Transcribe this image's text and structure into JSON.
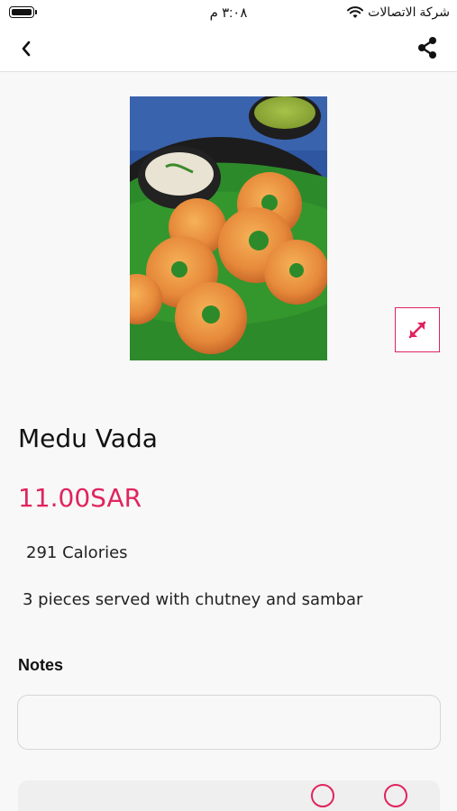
{
  "status_bar": {
    "carrier": "شركة الاتصالات",
    "time": "٣:٠٨ م"
  },
  "nav": {
    "back_icon": "chevron-left-icon",
    "share_icon": "share-icon"
  },
  "item": {
    "name": "Medu Vada",
    "price": "11.00SAR",
    "calories": "291 Calories",
    "description": "3 pieces served with chutney and sambar",
    "image_alt": "Medu Vada"
  },
  "notes": {
    "label": "Notes",
    "value": ""
  },
  "colors": {
    "accent": "#e0245e",
    "background": "#f8f8f8"
  }
}
